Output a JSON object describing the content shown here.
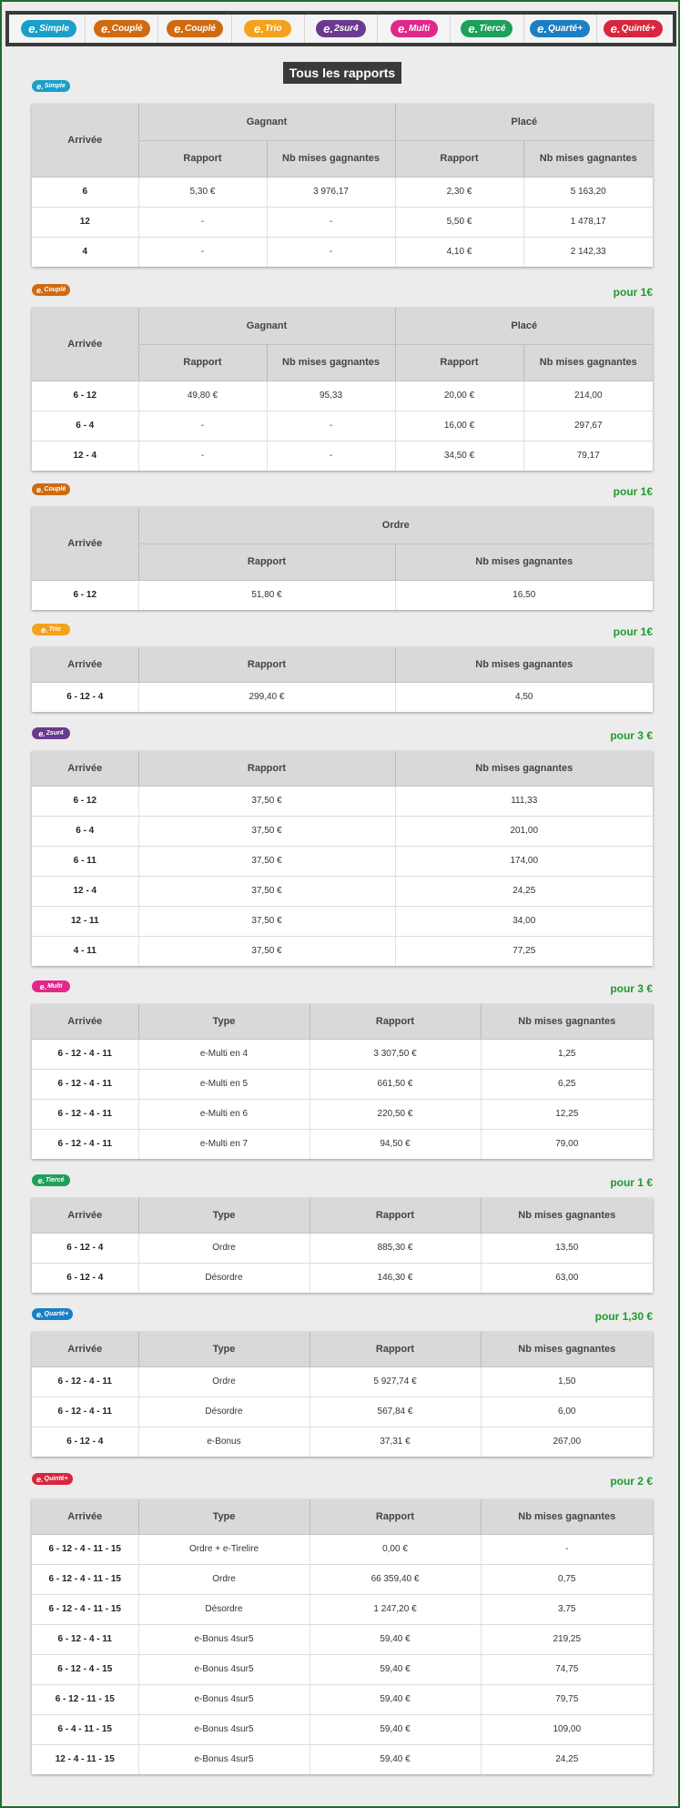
{
  "nav": [
    {
      "e": "e.",
      "name": "Simple",
      "color": "#1aa0c8"
    },
    {
      "e": "e.",
      "name": "Couplé",
      "color": "#d06a10"
    },
    {
      "e": "e.",
      "name": "Couplé",
      "color": "#d06a10"
    },
    {
      "e": "e.",
      "name": "Trio",
      "color": "#f4a21c"
    },
    {
      "e": "e.",
      "name": "2sur4",
      "color": "#6b3a8e"
    },
    {
      "e": "e.",
      "name": "Multi",
      "color": "#e2278a"
    },
    {
      "e": "e.",
      "name": "Tiercé",
      "color": "#1ea05a"
    },
    {
      "e": "e.",
      "name": "Quarté+",
      "color": "#1b7fc4"
    },
    {
      "e": "e.",
      "name": "Quinté+",
      "color": "#d7263d"
    }
  ],
  "page_title": "Tous les rapports",
  "headers": {
    "arrivee": "Arrivée",
    "gagnant": "Gagnant",
    "place": "Placé",
    "rapport": "Rapport",
    "nb": "Nb mises gagnantes",
    "ordre": "Ordre",
    "type": "Type"
  },
  "simple": {
    "logo": {
      "e": "e.",
      "name": "Simple"
    },
    "rows": [
      {
        "arr": "6",
        "g_rap": "5,30 €",
        "g_nb": "3 976,17",
        "p_rap": "2,30 €",
        "p_nb": "5 163,20"
      },
      {
        "arr": "12",
        "g_rap": "-",
        "g_nb": "-",
        "p_rap": "5,50 €",
        "p_nb": "1 478,17"
      },
      {
        "arr": "4",
        "g_rap": "-",
        "g_nb": "-",
        "p_rap": "4,10 €",
        "p_nb": "2 142,33"
      }
    ]
  },
  "couple": {
    "logo": {
      "e": "e.",
      "name": "Couplé"
    },
    "pour": "pour 1€",
    "rows": [
      {
        "arr": "6 - 12",
        "g_rap": "49,80 €",
        "g_nb": "95,33",
        "p_rap": "20,00 €",
        "p_nb": "214,00"
      },
      {
        "arr": "6 - 4",
        "g_rap": "-",
        "g_nb": "-",
        "p_rap": "16,00 €",
        "p_nb": "297,67"
      },
      {
        "arr": "12 - 4",
        "g_rap": "-",
        "g_nb": "-",
        "p_rap": "34,50 €",
        "p_nb": "79,17"
      }
    ]
  },
  "couple_ordre": {
    "logo": {
      "e": "e.",
      "name": "Couplé"
    },
    "pour": "pour 1€",
    "rows": [
      {
        "arr": "6 - 12",
        "rap": "51,80 €",
        "nb": "16,50"
      }
    ]
  },
  "trio": {
    "logo": {
      "e": "e.",
      "name": "Trio"
    },
    "pour": "pour 1€",
    "rows": [
      {
        "arr": "6 - 12 - 4",
        "rap": "299,40 €",
        "nb": "4,50"
      }
    ]
  },
  "sur4": {
    "logo": {
      "e": "e.",
      "name": "2sur4"
    },
    "pour": "pour 3 €",
    "rows": [
      {
        "arr": "6 - 12",
        "rap": "37,50 €",
        "nb": "111,33"
      },
      {
        "arr": "6 - 4",
        "rap": "37,50 €",
        "nb": "201,00"
      },
      {
        "arr": "6 - 11",
        "rap": "37,50 €",
        "nb": "174,00"
      },
      {
        "arr": "12 - 4",
        "rap": "37,50 €",
        "nb": "24,25"
      },
      {
        "arr": "12 - 11",
        "rap": "37,50 €",
        "nb": "34,00"
      },
      {
        "arr": "4 - 11",
        "rap": "37,50 €",
        "nb": "77,25"
      }
    ]
  },
  "multi": {
    "logo": {
      "e": "e.",
      "name": "Multi"
    },
    "pour": "pour 3 €",
    "rows": [
      {
        "arr": "6 - 12 - 4 - 11",
        "type": "e-Multi en 4",
        "rap": "3 307,50 €",
        "nb": "1,25"
      },
      {
        "arr": "6 - 12 - 4 - 11",
        "type": "e-Multi en 5",
        "rap": "661,50 €",
        "nb": "6,25"
      },
      {
        "arr": "6 - 12 - 4 - 11",
        "type": "e-Multi en 6",
        "rap": "220,50 €",
        "nb": "12,25"
      },
      {
        "arr": "6 - 12 - 4 - 11",
        "type": "e-Multi en 7",
        "rap": "94,50 €",
        "nb": "79,00"
      }
    ]
  },
  "tierce": {
    "logo": {
      "e": "e.",
      "name": "Tiercé"
    },
    "pour": "pour 1 €",
    "rows": [
      {
        "arr": "6 - 12 - 4",
        "type": "Ordre",
        "rap": "885,30 €",
        "nb": "13,50"
      },
      {
        "arr": "6 - 12 - 4",
        "type": "Désordre",
        "rap": "146,30 €",
        "nb": "63,00"
      }
    ]
  },
  "quarte": {
    "logo": {
      "e": "e.",
      "name": "Quarté+"
    },
    "pour": "pour 1,30 €",
    "rows": [
      {
        "arr": "6 - 12 - 4 - 11",
        "type": "Ordre",
        "rap": "5 927,74 €",
        "nb": "1,50"
      },
      {
        "arr": "6 - 12 - 4 - 11",
        "type": "Désordre",
        "rap": "567,84 €",
        "nb": "6,00"
      },
      {
        "arr": "6 - 12 - 4",
        "type": "e-Bonus",
        "rap": "37,31 €",
        "nb": "267,00"
      }
    ]
  },
  "quinte": {
    "logo": {
      "e": "e.",
      "name": "Quinté+"
    },
    "pour": "pour 2 €",
    "rows": [
      {
        "arr": "6 - 12 - 4 - 11 - 15",
        "type": "Ordre + e-Tirelire",
        "rap": "0,00 €",
        "nb": "-"
      },
      {
        "arr": "6 - 12 - 4 - 11 - 15",
        "type": "Ordre",
        "rap": "66 359,40 €",
        "nb": "0,75"
      },
      {
        "arr": "6 - 12 - 4 - 11 - 15",
        "type": "Désordre",
        "rap": "1 247,20 €",
        "nb": "3,75"
      },
      {
        "arr": "6 - 12 - 4 - 11",
        "type": "e-Bonus 4sur5",
        "rap": "59,40 €",
        "nb": "219,25"
      },
      {
        "arr": "6 - 12 - 4 - 15",
        "type": "e-Bonus 4sur5",
        "rap": "59,40 €",
        "nb": "74,75"
      },
      {
        "arr": "6 - 12 - 11 - 15",
        "type": "e-Bonus 4sur5",
        "rap": "59,40 €",
        "nb": "79,75"
      },
      {
        "arr": "6 - 4 - 11 - 15",
        "type": "e-Bonus 4sur5",
        "rap": "59,40 €",
        "nb": "109,00"
      },
      {
        "arr": "12 - 4 - 11 - 15",
        "type": "e-Bonus 4sur5",
        "rap": "59,40 €",
        "nb": "24,25"
      }
    ]
  }
}
